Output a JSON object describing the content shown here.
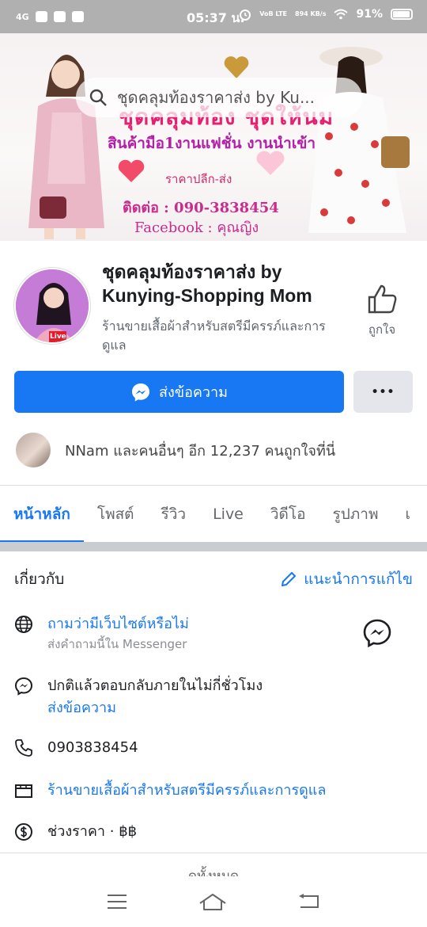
{
  "status_bar": {
    "network": "4G",
    "time": "05:37 น.",
    "volte": "VoB LTE",
    "speed": "894 KB/s",
    "battery": "91%"
  },
  "cover": {
    "search_text": "ชุดคลุมท้องราคาส่ง by Ku...",
    "line1": "ชุดคลุมท้อง ชุดให้นม",
    "line2": "สินค้ามือ1งานแฟชั่น งานนำเข้า",
    "line3": "ราคาปลีก-ส่ง",
    "line4": "ติดต่อ : 090-3838454",
    "line5": "Facebook : คุณญิง"
  },
  "profile": {
    "name": "ชุดคลุมท้องราคาส่ง by Kunying-Shopping Mom",
    "category": "ร้านขายเสื้อผ้าสำหรับสตรีมีครรภ์และการดูแล",
    "like_label": "ถูกใจ",
    "live_badge": "Live"
  },
  "actions": {
    "message_label": "ส่งข้อความ",
    "more_label": "•••"
  },
  "friends": {
    "text": "NNam และคนอื่นๆ อีก 12,237 คนถูกใจที่นี่"
  },
  "tabs": [
    {
      "label": "หน้าหลัก",
      "active": true
    },
    {
      "label": "โพสต์",
      "active": false
    },
    {
      "label": "รีวิว",
      "active": false
    },
    {
      "label": "Live",
      "active": false
    },
    {
      "label": "วิดีโอ",
      "active": false
    },
    {
      "label": "รูปภาพ",
      "active": false
    },
    {
      "label": "เ",
      "active": false
    }
  ],
  "about": {
    "heading": "เกี่ยวกับ",
    "edit_label": "แนะนำการแก้ไข",
    "website_main": "ถามว่ามีเว็บไซต์หรือไม่",
    "website_sub": "ส่งคำถามนี้ใน Messenger",
    "response_main": "ปกติแล้วตอบกลับภายในไม่กี่ชั่วโมง",
    "response_sub": "ส่งข้อความ",
    "phone": "0903838454",
    "category": "ร้านขายเสื้อผ้าสำหรับสตรีมีครรภ์และการดูแล",
    "price_range": "ช่วงราคา · ฿฿",
    "see_all": "ดูทั้งหมด"
  },
  "colors": {
    "accent": "#1877f2",
    "status_bar": "#b0b0b0",
    "secondary_button": "#e4e6eb"
  }
}
